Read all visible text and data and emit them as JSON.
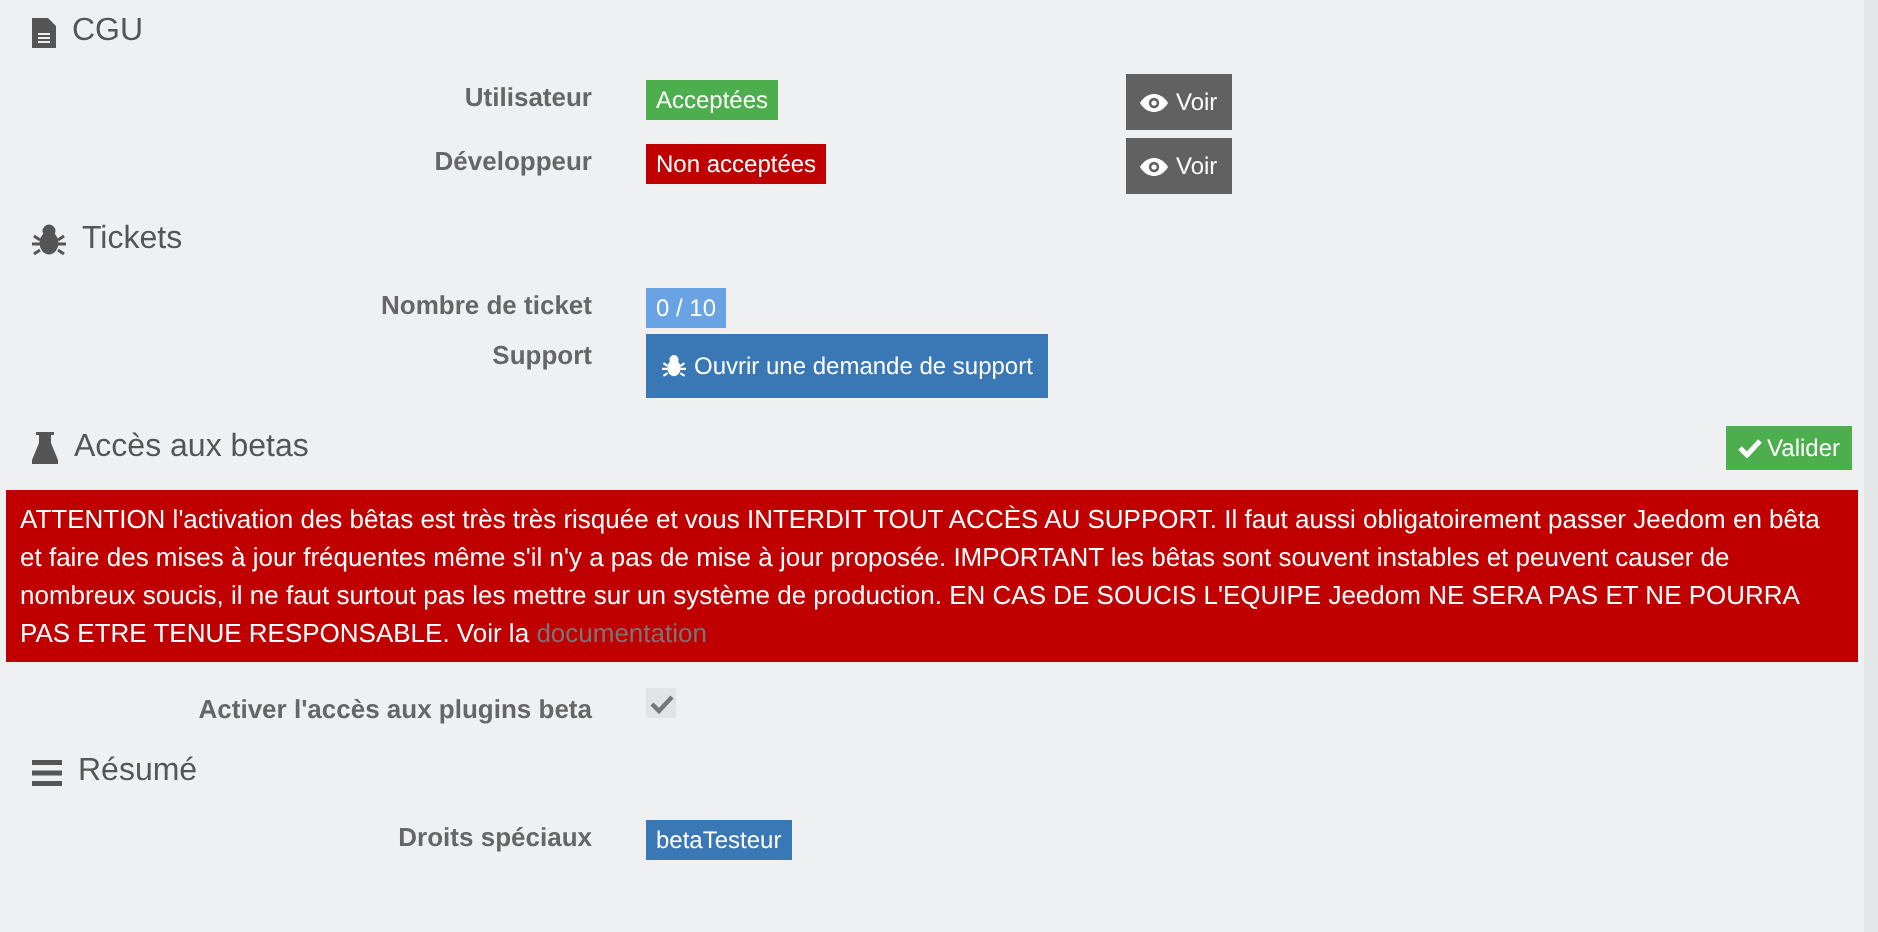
{
  "sections": [
    {
      "title": "CGU",
      "rows": [
        {
          "label": "Utilisateur",
          "kind": "badge",
          "value": "Acceptées",
          "color": "#4cae4c",
          "button": "Voir"
        },
        {
          "label": "Développeur",
          "kind": "badge",
          "value": "Non acceptées",
          "color": "#c00000",
          "button": "Voir"
        }
      ]
    },
    {
      "title": "Tickets",
      "rows": [
        {
          "label": "Nombre de ticket",
          "kind": "badge",
          "value": "0 / 10",
          "color": "#6aa3e3"
        },
        {
          "label": "Support",
          "kind": "action",
          "value": "Ouvrir une demande de support"
        }
      ]
    },
    {
      "title": "Accès aux betas",
      "action": "Valider",
      "alert": {
        "text": "ATTENTION l'activation des bêtas est très très risquée et vous INTERDIT TOUT ACCÈS AU SUPPORT. Il faut aussi obligatoirement passer Jeedom en bêta et faire des mises à jour fréquentes même s'il n'y a pas de mise à jour proposée. IMPORTANT les bêtas sont souvent instables et peuvent causer de nombreux soucis, il ne faut surtout pas les mettre sur un système de production. EN CAS DE SOUCIS L'EQUIPE Jeedom NE SERA PAS ET NE POURRA PAS ETRE TENUE RESPONSABLE. Voir la",
        "link": "documentation"
      },
      "rows": [
        {
          "label": "Activer l'accès aux plugins beta",
          "kind": "checkbox",
          "checked": true
        }
      ]
    },
    {
      "title": "Résumé",
      "rows": [
        {
          "label": "Droits spéciaux",
          "kind": "badge",
          "value": "betaTesteur",
          "color": "#3a77b5"
        }
      ]
    }
  ]
}
